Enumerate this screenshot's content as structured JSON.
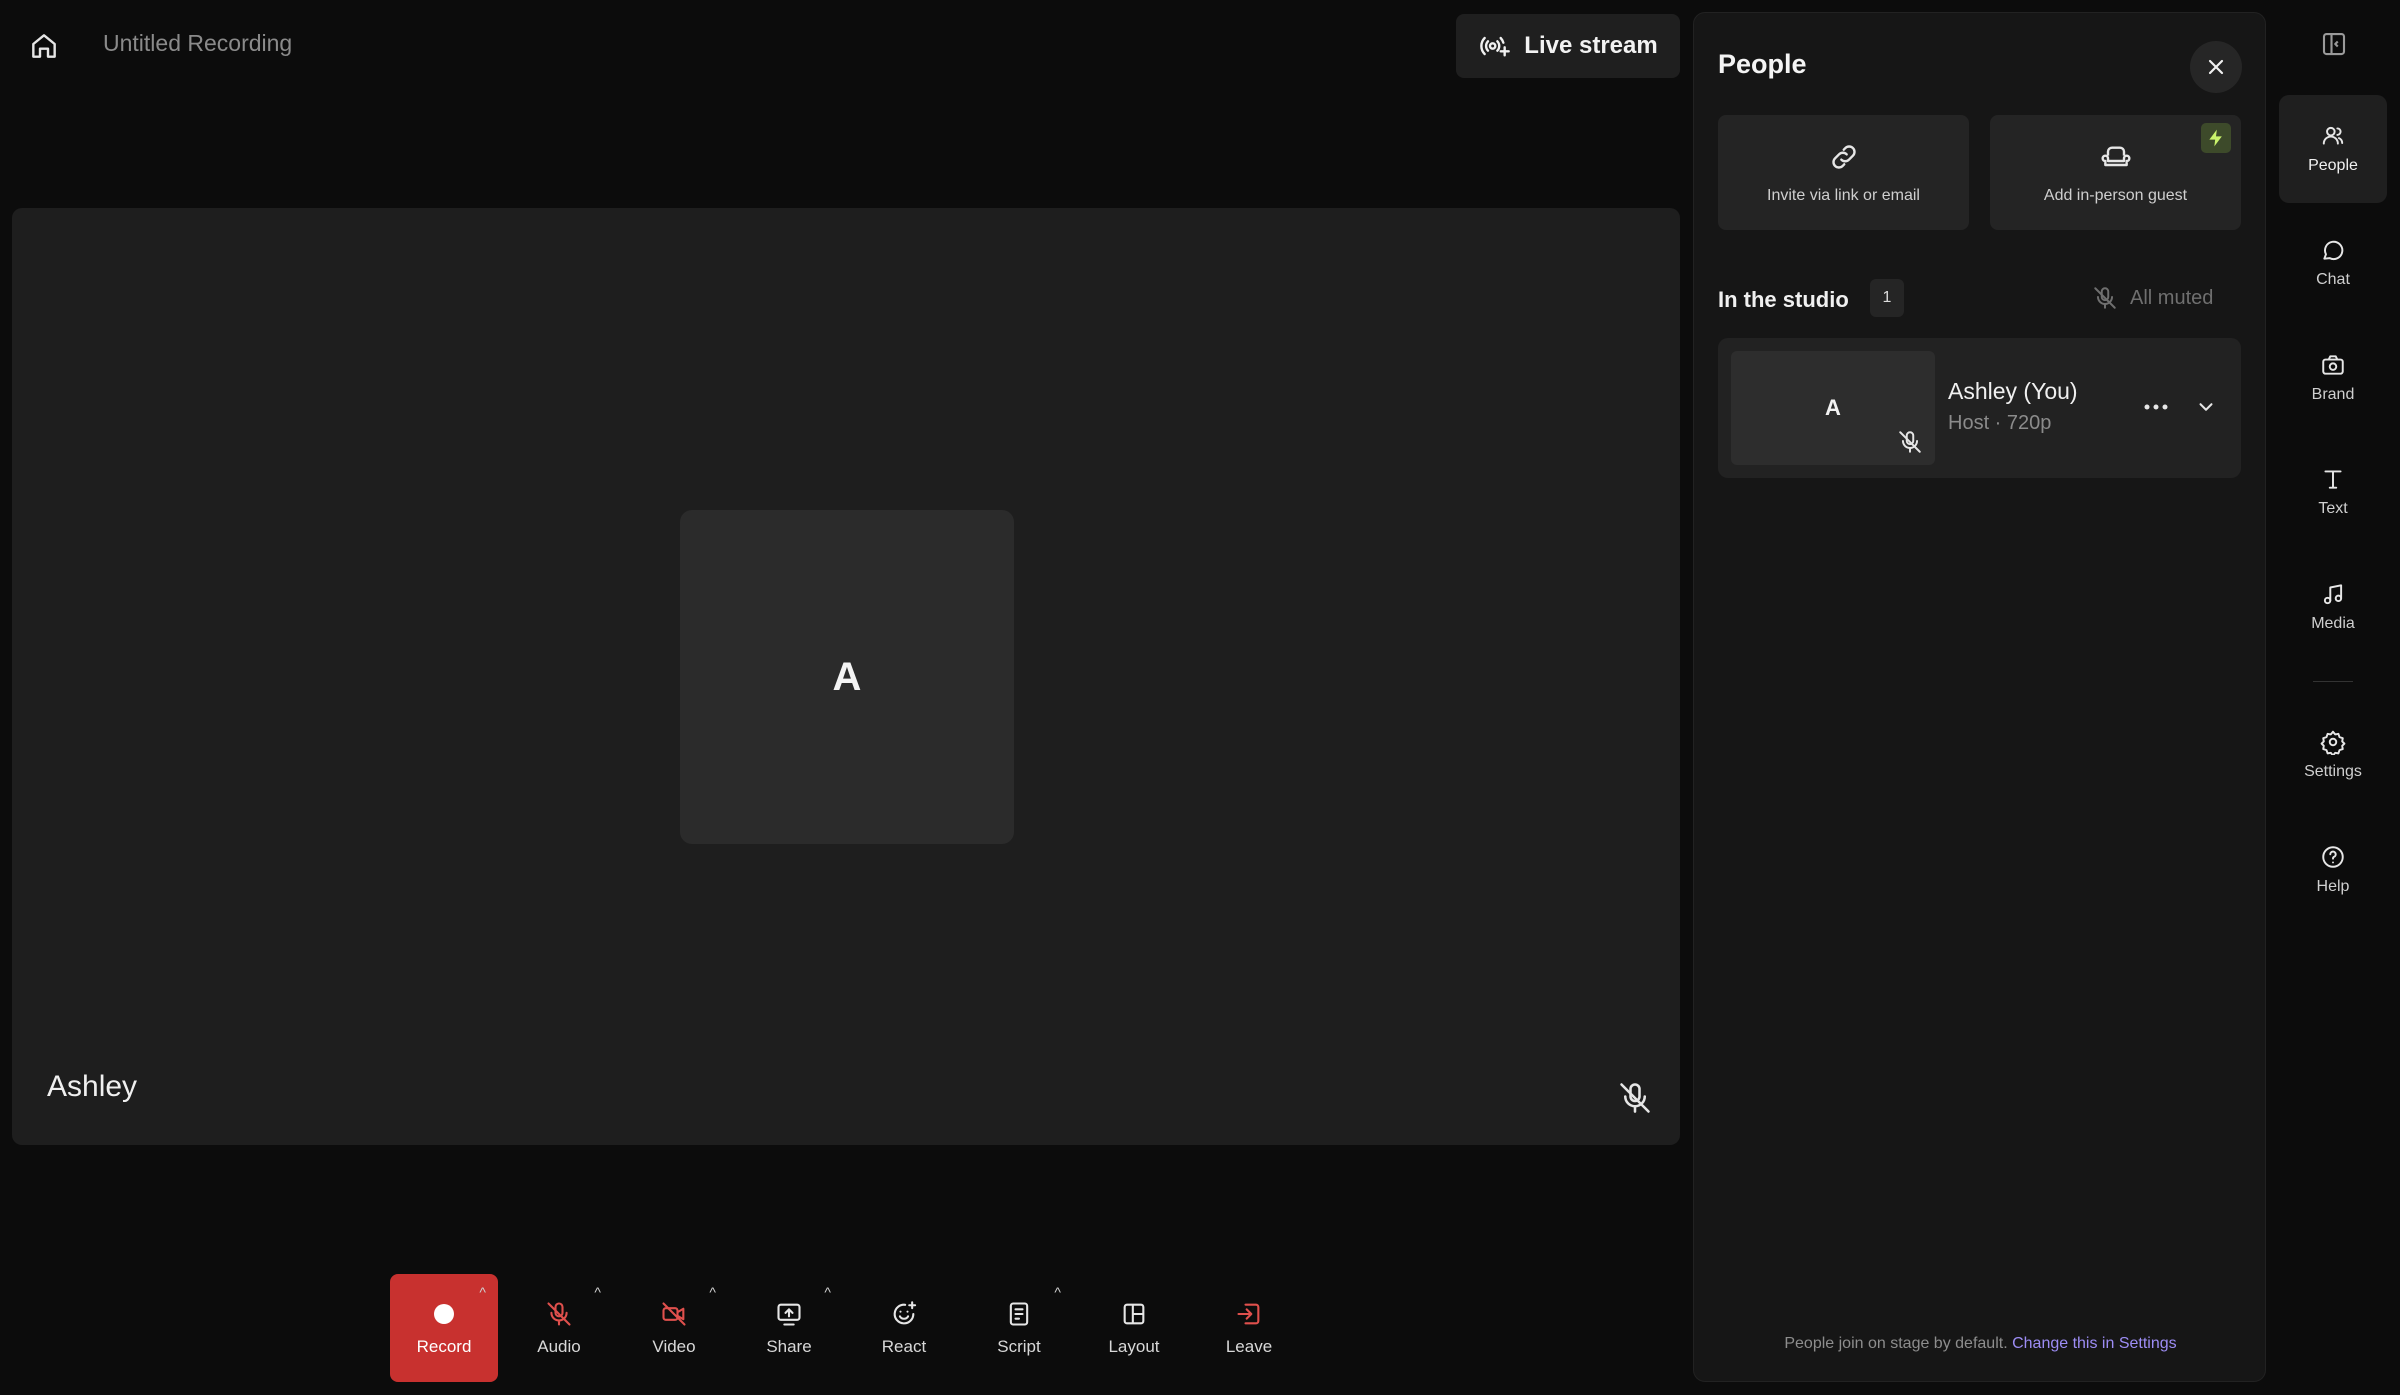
{
  "header": {
    "title": "Untitled Recording",
    "live_stream_label": "Live stream"
  },
  "stage": {
    "avatar_letter": "A",
    "participant_name": "Ashley"
  },
  "toolbar": {
    "items": [
      {
        "label": "Record"
      },
      {
        "label": "Audio"
      },
      {
        "label": "Video"
      },
      {
        "label": "Share"
      },
      {
        "label": "React"
      },
      {
        "label": "Script"
      },
      {
        "label": "Layout"
      },
      {
        "label": "Leave"
      }
    ]
  },
  "panel": {
    "title": "People",
    "invite_label": "Invite via link or email",
    "guest_label": "Add in-person guest",
    "studio_label": "In the studio",
    "studio_count": "1",
    "all_muted_label": "All muted",
    "person": {
      "avatar_letter": "A",
      "name": "Ashley (You)",
      "role": "Host · 720p"
    },
    "footer_text": "People join on stage by default.",
    "footer_link": "Change this in Settings"
  },
  "rail": {
    "items": [
      {
        "label": "People"
      },
      {
        "label": "Chat"
      },
      {
        "label": "Brand"
      },
      {
        "label": "Text"
      },
      {
        "label": "Media"
      },
      {
        "label": "Settings"
      },
      {
        "label": "Help"
      }
    ]
  },
  "colors": {
    "record_red": "#c8312f",
    "muted_red": "#e0504d",
    "link_purple": "#9d8df5",
    "bolt_green": "#c9f26b"
  }
}
